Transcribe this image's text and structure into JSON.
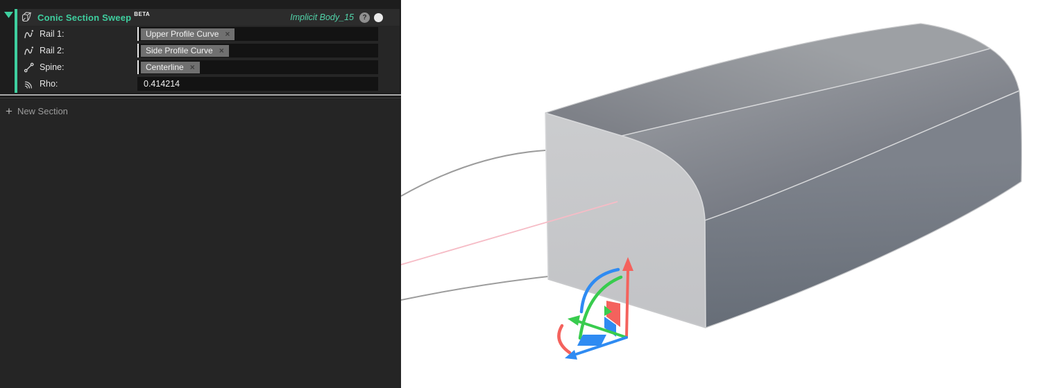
{
  "panel": {
    "header": {
      "title": "Conic Section Sweep",
      "beta_badge": "BETA",
      "body_name": "Implicit Body_15",
      "help_glyph": "?"
    },
    "rows": [
      {
        "icon": "curve-icon",
        "label": "Rail 1:",
        "chip": "Upper Profile Curve",
        "remove": "×"
      },
      {
        "icon": "curve-icon",
        "label": "Rail 2:",
        "chip": "Side Profile Curve",
        "remove": "×"
      },
      {
        "icon": "polyline-icon",
        "label": "Spine:",
        "chip": "Centerline",
        "remove": "×"
      },
      {
        "icon": "rho-icon",
        "label": "Rho:",
        "value": "0.414214"
      }
    ],
    "new_section": {
      "plus": "+",
      "label": "New Section"
    }
  },
  "icons": {
    "collapse": "triangle-down",
    "help": "question-mark-circle",
    "visibility": "filled-circle",
    "rail": "wavy-curve-with-dot",
    "spine": "segment-with-endpoints",
    "rho": "concentric-arcs"
  },
  "colors": {
    "accent_teal": "#3ecf9f",
    "body_name_teal": "#52d4aa",
    "panel_bg": "#262626",
    "field_bg": "#131313",
    "chip_bg": "#707070",
    "curve_gray": "#9c9c9c",
    "centerline_pink": "#f6bcc6",
    "gizmo_red": "#f4625d",
    "gizmo_green": "#38cc4e",
    "gizmo_blue": "#2f8bf2",
    "viewport_bg": "#ffffff"
  }
}
